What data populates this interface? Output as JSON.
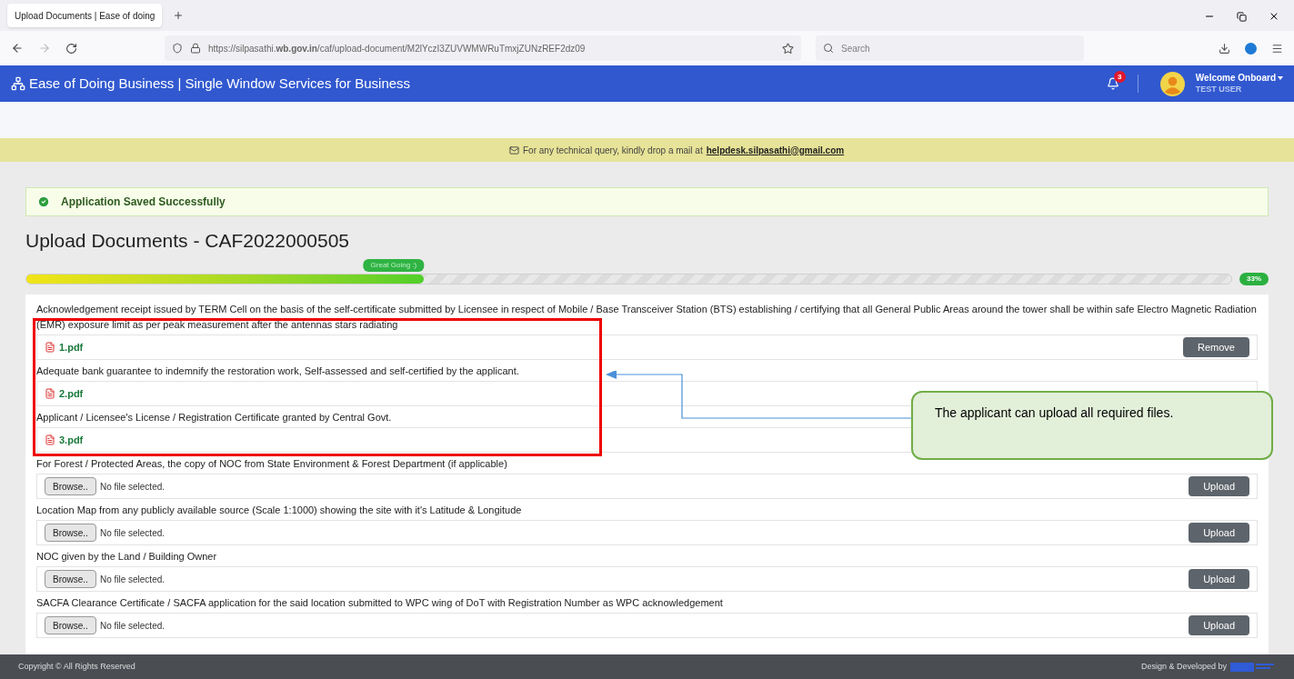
{
  "browser": {
    "tab_title": "Upload Documents | Ease of doing",
    "url": "https://silpasathi.**wb.gov.in**/caf/upload-document/M2lYczI3ZUVWMWRuTmxjZUNzREF2dz09",
    "search_placeholder": "Search"
  },
  "header": {
    "brand": "Ease of Doing Business | Single Window Services for Business",
    "notification_count": "3",
    "greeting": "Welcome Onboard",
    "user": "TEST USER"
  },
  "notice": {
    "text": "For any technical query, kindly drop a mail at",
    "email": "helpdesk.silpasathi@gmail.com"
  },
  "alert": {
    "text": "Application Saved Successfully"
  },
  "page_title": "Upload Documents - CAF2022000505",
  "progress": {
    "level": 0.33,
    "bubble": "Great Going :)",
    "reading": "33%"
  },
  "documents": [
    {
      "kind": "uploaded",
      "label": "Acknowledgement receipt issued by TERM Cell on the basis of the self-certificate submitted by Licensee in respect of Mobile / Base Transceiver Station (BTS) establishing / certifying that all General Public Areas around the tower shall be within safe Electro Magnetic Radiation (EMR) exposure limit as per peak measurement after the antennas stars radiating",
      "file": "1.pdf",
      "action": "Remove"
    },
    {
      "kind": "uploaded",
      "label": "Adequate bank guarantee to indemnify the restoration work, Self-assessed and self-certified by the applicant.",
      "file": "2.pdf"
    },
    {
      "kind": "uploaded",
      "label": "Applicant / Licensee's License / Registration Certificate granted by Central Govt.",
      "file": "3.pdf"
    },
    {
      "kind": "pending",
      "label": "For Forest / Protected Areas, the copy of NOC from State Environment & Forest Department (if applicable)",
      "browse": "Browse..",
      "status": "No file selected.",
      "action": "Upload"
    },
    {
      "kind": "pending",
      "label": "Location Map from any publicly available source (Scale 1:1000) showing the site with it's Latitude & Longitude",
      "browse": "Browse..",
      "status": "No file selected.",
      "action": "Upload"
    },
    {
      "kind": "pending",
      "label": "NOC given by the Land / Building Owner",
      "browse": "Browse..",
      "status": "No file selected.",
      "action": "Upload"
    },
    {
      "kind": "pending",
      "label": "SACFA Clearance Certificate / SACFA application for the said location submitted to WPC wing of DoT with Registration Number as WPC acknowledgement",
      "browse": "Browse..",
      "status": "No file selected.",
      "action": "Upload"
    }
  ],
  "annotation": {
    "text": "The applicant can upload all required files."
  },
  "footer": {
    "copyright": "Copyright © All Rights Reserved",
    "credit": "Design & Developed by"
  }
}
